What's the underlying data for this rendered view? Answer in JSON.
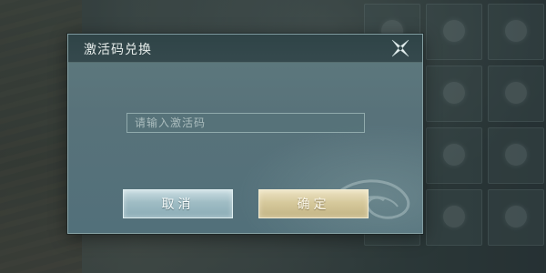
{
  "dialog": {
    "title": "激活码兑换",
    "close_icon": "close-x-icon",
    "input": {
      "value": "",
      "placeholder": "请输入激活码"
    },
    "buttons": {
      "cancel_label": "取消",
      "confirm_label": "确定"
    }
  },
  "colors": {
    "dialog_body": "#58727a",
    "dialog_header": "#2f4447",
    "cancel_button": "#9fbcc4",
    "confirm_button": "#d6c99c"
  }
}
